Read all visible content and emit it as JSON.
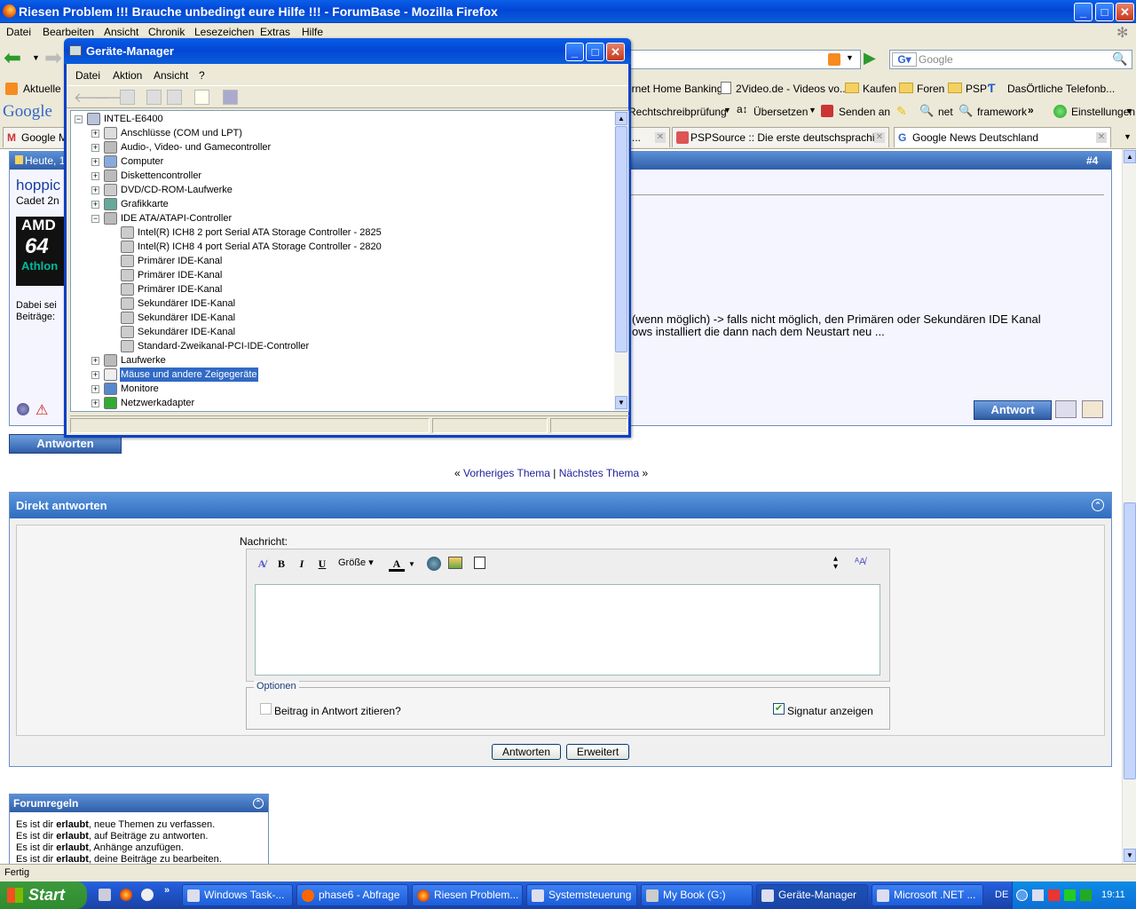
{
  "firefox": {
    "title": "Riesen Problem !!! Brauche unbedingt eure Hilfe !!! - ForumBase - Mozilla Firefox",
    "menu": [
      "Datei",
      "Bearbeiten",
      "Ansicht",
      "Chronik",
      "Lesezeichen",
      "Extras",
      "Hilfe"
    ],
    "search_placeholder": "Google",
    "bookmarks": [
      "Aktuelle N",
      "ernet Home Banking",
      "2Video.de - Videos vo...",
      "Kaufen",
      "Foren",
      "PSP",
      "DasÖrtliche Telefonb..."
    ],
    "google_toolbar": {
      "logo": "Google",
      "items": [
        "Rechtschreibprüfung",
        "Übersetzen",
        "Senden an",
        "net",
        "framework",
        "Einstellungen"
      ]
    },
    "tabs": [
      "Google M",
      "PSPSource :: Die erste deutschsprachi...",
      "Google News Deutschland"
    ],
    "status": "Fertig"
  },
  "post": {
    "header_left": "Heute, 1",
    "header_right": "#4",
    "username": "hoppic",
    "rank": "Cadet 2n",
    "avatar_text": [
      "AMD",
      "64",
      "Athlon"
    ],
    "meta": [
      "Dabei sei",
      "Beiträge:"
    ],
    "body_line1": "(wenn möglich) -> falls nicht möglich, den Primären oder Sekundären IDE Kanal",
    "body_line2": "ows installiert die dann nach dem Neustart neu ...",
    "reply_button": "Antwort",
    "answer_button": "Antworten"
  },
  "thread_nav": {
    "prev": "Vorheriges Thema",
    "sep": "|",
    "next": "Nächstes Thema",
    "left_q": "«",
    "right_q": "»"
  },
  "quick_reply": {
    "title": "Direkt antworten",
    "message_label": "Nachricht:",
    "size_label": "Größe",
    "options_legend": "Optionen",
    "quote_label": "Beitrag in Antwort zitieren?",
    "signature_label": "Signatur anzeigen",
    "submit": "Antworten",
    "advanced": "Erweitert"
  },
  "forum_rules": {
    "title": "Forumregeln",
    "lines": [
      {
        "pre": "Es ist dir ",
        "bold": "erlaubt",
        "post": ", neue Themen zu verfassen."
      },
      {
        "pre": "Es ist dir ",
        "bold": "erlaubt",
        "post": ", auf Beiträge zu antworten."
      },
      {
        "pre": "Es ist dir ",
        "bold": "erlaubt",
        "post": ", Anhänge anzufügen."
      },
      {
        "pre": "Es ist dir ",
        "bold": "erlaubt",
        "post": ", deine Beiträge zu bearbeiten."
      }
    ]
  },
  "device_manager": {
    "title": "Geräte-Manager",
    "menu": [
      "Datei",
      "Aktion",
      "Ansicht",
      "?"
    ],
    "root": "INTEL-E6400",
    "nodes": [
      {
        "label": "Anschlüsse (COM und LPT)",
        "level": 1,
        "exp": "+"
      },
      {
        "label": "Audio-, Video- und Gamecontroller",
        "level": 1,
        "exp": "+"
      },
      {
        "label": "Computer",
        "level": 1,
        "exp": "+"
      },
      {
        "label": "Diskettencontroller",
        "level": 1,
        "exp": "+"
      },
      {
        "label": "DVD/CD-ROM-Laufwerke",
        "level": 1,
        "exp": "+"
      },
      {
        "label": "Grafikkarte",
        "level": 1,
        "exp": "+"
      },
      {
        "label": "IDE ATA/ATAPI-Controller",
        "level": 1,
        "exp": "-"
      },
      {
        "label": "Intel(R) ICH8 2 port Serial ATA Storage Controller - 2825",
        "level": 2,
        "exp": ""
      },
      {
        "label": "Intel(R) ICH8 4 port Serial ATA Storage Controller - 2820",
        "level": 2,
        "exp": ""
      },
      {
        "label": "Primärer IDE-Kanal",
        "level": 2,
        "exp": ""
      },
      {
        "label": "Primärer IDE-Kanal",
        "level": 2,
        "exp": ""
      },
      {
        "label": "Primärer IDE-Kanal",
        "level": 2,
        "exp": ""
      },
      {
        "label": "Sekundärer IDE-Kanal",
        "level": 2,
        "exp": ""
      },
      {
        "label": "Sekundärer IDE-Kanal",
        "level": 2,
        "exp": ""
      },
      {
        "label": "Sekundärer IDE-Kanal",
        "level": 2,
        "exp": ""
      },
      {
        "label": "Standard-Zweikanal-PCI-IDE-Controller",
        "level": 2,
        "exp": ""
      },
      {
        "label": "Laufwerke",
        "level": 1,
        "exp": "+"
      },
      {
        "label": "Mäuse und andere Zeigegeräte",
        "level": 1,
        "exp": "+",
        "selected": true
      },
      {
        "label": "Monitore",
        "level": 1,
        "exp": "+"
      },
      {
        "label": "Netzwerkadapter",
        "level": 1,
        "exp": "+"
      }
    ]
  },
  "taskbar": {
    "start": "Start",
    "tasks": [
      "Windows Task-...",
      "phase6 - Abfrage",
      "Riesen Problem...",
      "Systemsteuerung",
      "My Book (G:)",
      "Geräte-Manager",
      "Microsoft .NET ..."
    ],
    "lang": "DE",
    "clock": "19:11"
  }
}
